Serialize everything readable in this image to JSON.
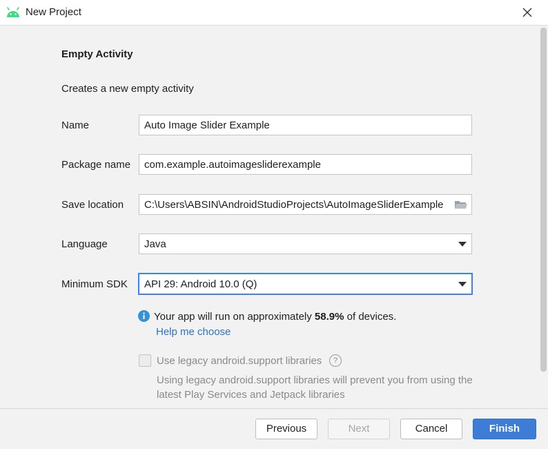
{
  "window": {
    "title": "New Project",
    "logo": "android-icon",
    "close": "close-icon"
  },
  "heading": "Empty Activity",
  "description": "Creates a new empty activity",
  "form": {
    "name_label": "Name",
    "name_value": "Auto Image Slider Example",
    "package_label": "Package name",
    "package_value": "com.example.autoimagesliderexample",
    "location_label": "Save location",
    "location_value": "C:\\Users\\ABSIN\\AndroidStudioProjects\\AutoImageSliderExample",
    "language_label": "Language",
    "language_value": "Java",
    "sdk_label": "Minimum SDK",
    "sdk_value": "API 29: Android 10.0 (Q)"
  },
  "info": {
    "prefix": "Your app will run on approximately ",
    "percent": "58.9%",
    "suffix": " of devices.",
    "help_link": "Help me choose"
  },
  "legacy": {
    "label": "Use legacy android.support libraries",
    "help_glyph": "?",
    "description": "Using legacy android.support libraries will prevent you from using the latest Play Services and Jetpack libraries"
  },
  "buttons": {
    "previous": "Previous",
    "next": "Next",
    "cancel": "Cancel",
    "finish": "Finish"
  },
  "colors": {
    "accent": "#3d7dd8",
    "link": "#2a73c9",
    "android_green": "#3ddc84",
    "info_blue": "#3592d4"
  }
}
